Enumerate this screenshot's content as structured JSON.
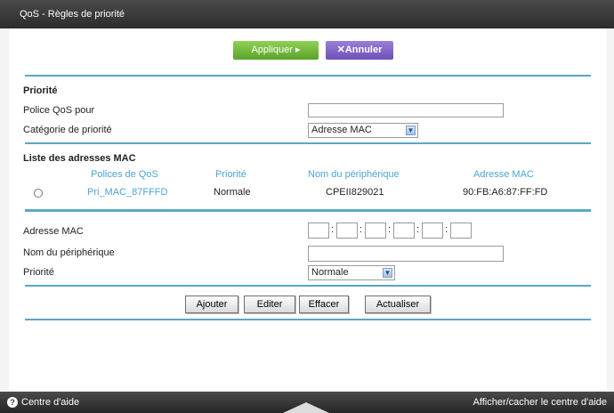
{
  "window": {
    "title": "QoS - Règles de priorité"
  },
  "toolbar": {
    "apply_label": "Appliquer ▸",
    "cancel_label": "✕Annuler"
  },
  "priority_section": {
    "heading": "Priorité",
    "qos_policy_label": "Police QoS pour",
    "qos_policy_value": "",
    "category_label": "Catégorie de priorité",
    "category_value": "Adresse MAC"
  },
  "mac_list": {
    "heading": "Liste des adresses MAC",
    "columns": [
      "Polices de QoS",
      "Priorité",
      "Nom du périphérique",
      "Adresse MAC"
    ],
    "rows": [
      {
        "policy": "Pri_MAC_87FFFD",
        "priority": "Normale",
        "device": "CPEII829021",
        "mac": "90:FB:A6:87:FF:FD"
      }
    ]
  },
  "form": {
    "mac_label": "Adresse MAC",
    "device_label": "Nom du périphérique",
    "priority_label": "Priorité",
    "priority_value": "Normale",
    "mac_separator": ":"
  },
  "actions": {
    "add": "Ajouter",
    "edit": "Editer",
    "delete": "Effacer",
    "refresh": "Actualiser"
  },
  "footer": {
    "help_label": "Centre d'aide",
    "toggle_label": "Afficher/cacher le centre d'aide",
    "help_glyph": "?"
  },
  "colors": {
    "apply": "#5aa22a",
    "cancel": "#6e4fb8",
    "header_text": "#4ba3d6",
    "separator": "#5aa6c8"
  }
}
